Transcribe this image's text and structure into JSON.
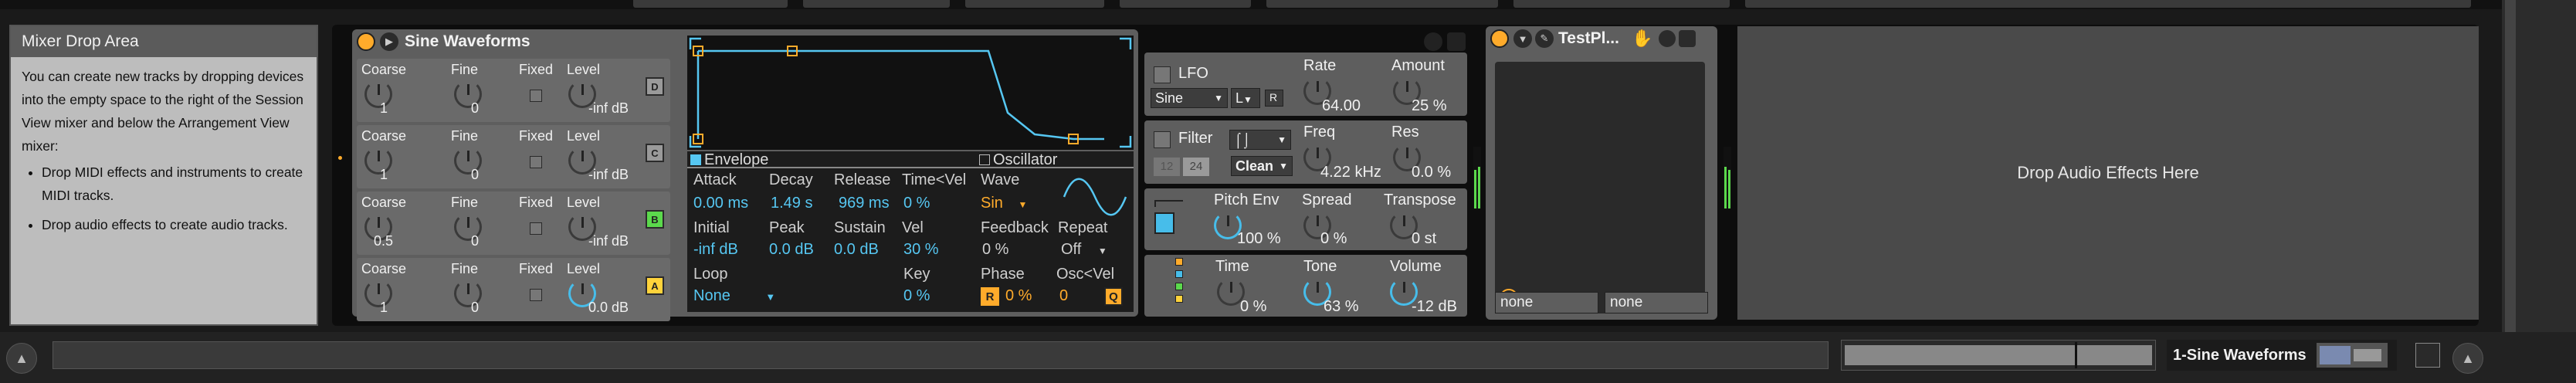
{
  "info": {
    "title": "Mixer Drop Area",
    "body": "You can create new tracks by dropping devices into the empty space to the right of the Session View mixer and below the Arrangement View mixer:",
    "bullets": [
      "Drop MIDI effects and instruments to create MIDI tracks.",
      "Drop audio effects to create audio tracks."
    ]
  },
  "operator": {
    "title": "Sine Waveforms",
    "oscillators": [
      {
        "coarse_label": "Coarse",
        "coarse": "1",
        "fine_label": "Fine",
        "fine": "0",
        "fixed_label": "Fixed",
        "level_label": "Level",
        "level": "-inf dB",
        "letter": "D"
      },
      {
        "coarse_label": "Coarse",
        "coarse": "1",
        "fine_label": "Fine",
        "fine": "0",
        "fixed_label": "Fixed",
        "level_label": "Level",
        "level": "-inf dB",
        "letter": "C"
      },
      {
        "coarse_label": "Coarse",
        "coarse": "0.5",
        "fine_label": "Fine",
        "fine": "0",
        "fixed_label": "Fixed",
        "level_label": "Level",
        "level": "-inf dB",
        "letter": "B"
      },
      {
        "coarse_label": "Coarse",
        "coarse": "1",
        "fine_label": "Fine",
        "fine": "0",
        "fixed_label": "Fixed",
        "level_label": "Level",
        "level": "0.0 dB",
        "letter": "A"
      }
    ],
    "envelope": {
      "section_label": "Envelope",
      "oscillator_label": "Oscillator",
      "attack_label": "Attack",
      "attack": "0.00 ms",
      "decay_label": "Decay",
      "decay": "1.49 s",
      "release_label": "Release",
      "release": "969 ms",
      "timevel_label": "Time<Vel",
      "timevel": "0 %",
      "initial_label": "Initial",
      "initial": "-inf dB",
      "peak_label": "Peak",
      "peak": "0.0 dB",
      "sustain_label": "Sustain",
      "sustain": "0.0 dB",
      "vel_label": "Vel",
      "vel": "30 %",
      "loop_label": "Loop",
      "loop": "None",
      "key_label": "Key",
      "key": "0 %",
      "wave_label": "Wave",
      "wave": "Sin",
      "feedback_label": "Feedback",
      "feedback": "0 %",
      "repeat_label": "Repeat",
      "repeat": "Off",
      "phase_label": "Phase",
      "phase": "0 %",
      "phase_r": "R",
      "oscvel_label": "Osc<Vel",
      "oscvel": "0",
      "oscvel_q": "Q"
    },
    "lfo": {
      "label": "LFO",
      "waveform": "Sine",
      "dest": "L",
      "retrig": "R",
      "rate_label": "Rate",
      "rate": "64.00",
      "amount_label": "Amount",
      "amount": "25 %"
    },
    "filter": {
      "label": "Filter",
      "slope_12": "12",
      "slope_24": "24",
      "mode": "Clean",
      "freq_label": "Freq",
      "freq": "4.22 kHz",
      "res_label": "Res",
      "res": "0.0 %"
    },
    "pitch": {
      "pitchenv_label": "Pitch Env",
      "pitchenv": "100 %",
      "spread_label": "Spread",
      "spread": "0 %",
      "transpose_label": "Transpose",
      "transpose": "0 st"
    },
    "mix": {
      "time_label": "Time",
      "time": "0 %",
      "tone_label": "Tone",
      "tone": "63 %",
      "volume_label": "Volume",
      "volume": "-12 dB"
    }
  },
  "testplugin": {
    "title": "TestPl...",
    "slot1": "none",
    "slot2": "none"
  },
  "dropzone": {
    "label": "Drop Audio Effects Here"
  },
  "bottom": {
    "track_name": "1-Sine Waveforms"
  },
  "colors": {
    "accent_blue": "#47bdea",
    "accent_orange": "#ffab2b",
    "green": "#5bd94c",
    "yellow": "#ffd33b"
  }
}
